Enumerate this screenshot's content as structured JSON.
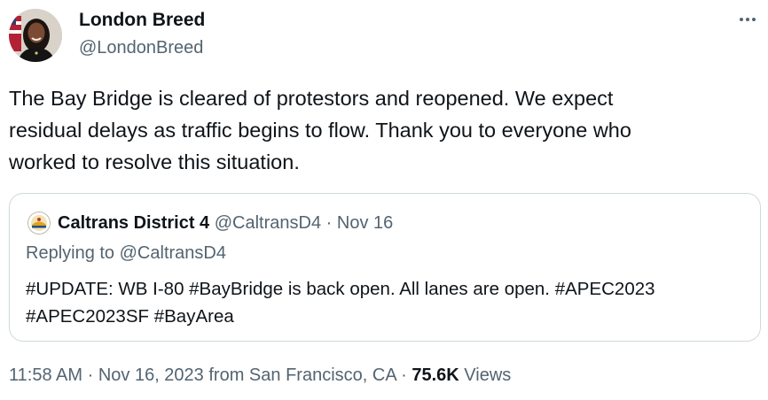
{
  "author": {
    "name": "London Breed",
    "handle": "@LondonBreed",
    "avatar_icon": "profile-photo"
  },
  "menu": {
    "icon": "more-horizontal-icon"
  },
  "tweet": {
    "text": "The Bay Bridge is cleared of protestors and reopened. We expect\nresidual delays as traffic begins to flow. Thank you to everyone who\nworked to resolve this situation."
  },
  "quoted": {
    "author_name": "Caltrans District 4",
    "handle": "@CaltransD4",
    "separator": "·",
    "date": "Nov 16",
    "replying_prefix": "Replying to",
    "replying_handle": "@CaltransD4",
    "text": "#UPDATE: WB I-80 #BayBridge is back open. All lanes are open. #APEC2023\n#APEC2023SF #BayArea",
    "avatar_icon": "caltrans-logo"
  },
  "footer": {
    "time": "11:58 AM",
    "separator1": "·",
    "date": "Nov 16, 2023",
    "source": "from San Francisco, CA",
    "separator2": "·",
    "views_count": "75.6K",
    "views_label": "Views"
  },
  "colors": {
    "text_primary": "#0f1419",
    "text_secondary": "#536471",
    "border": "#cfd9de"
  }
}
